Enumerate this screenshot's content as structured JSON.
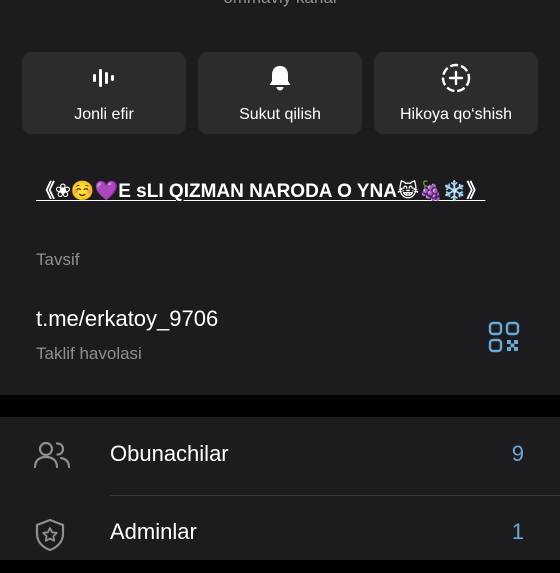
{
  "header": {
    "subtitle": "ommaviy kanal"
  },
  "actions": [
    {
      "label": "Jonli efir",
      "icon": "live-stream-icon"
    },
    {
      "label": "Sukut qilish",
      "icon": "bell-icon"
    },
    {
      "label": "Hikoya qo‘shish",
      "icon": "add-story-icon"
    }
  ],
  "description": {
    "value": "《❀☺️💜E sLI QIZMAN NARODA O YNA😹🍇❄️》",
    "label": "Tavsif"
  },
  "invite_link": {
    "value": "t.me/erkatoy_9706",
    "label": "Taklif havolasi",
    "icon": "qr-code-icon"
  },
  "rows": [
    {
      "label": "Obunachilar",
      "count": "9",
      "icon": "users-icon"
    },
    {
      "label": "Adminlar",
      "count": "1",
      "icon": "admin-shield-icon"
    }
  ],
  "colors": {
    "background": "#000000",
    "panel": "#1c1c1e",
    "button": "#2c2c2e",
    "secondary_text": "#8e8e93",
    "accent": "#6aa8d6"
  }
}
